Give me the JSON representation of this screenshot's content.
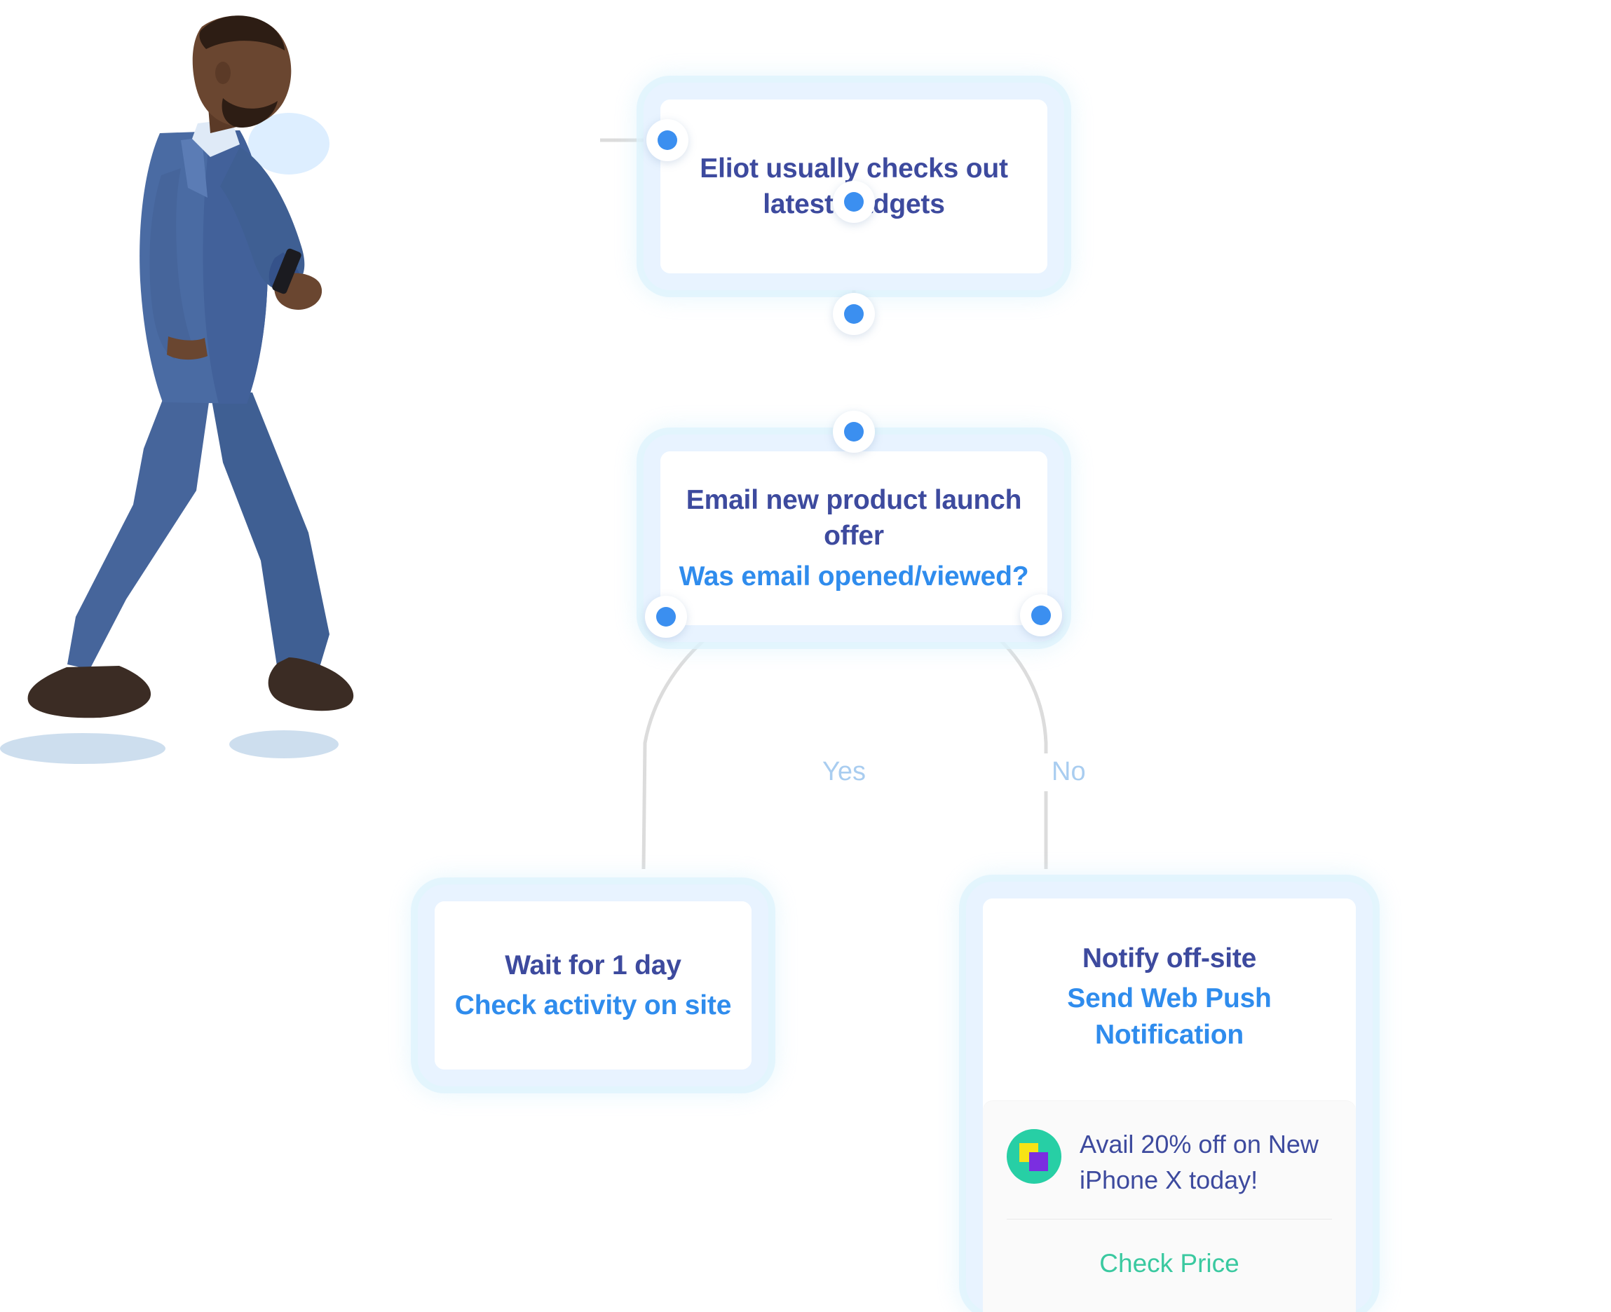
{
  "flow": {
    "nodes": [
      {
        "id": "node-1",
        "title": "Eliot usually checks out latest gadgets",
        "subtitle": ""
      },
      {
        "id": "node-2",
        "title": "Email new product launch offer",
        "subtitle": "Was email opened/viewed?"
      },
      {
        "id": "node-3",
        "title": "Wait for 1 day",
        "subtitle": "Check activity on site"
      },
      {
        "id": "node-4",
        "title": "Notify off-site",
        "subtitle": "Send Web Push Notification"
      }
    ],
    "branch_labels": {
      "yes": "Yes",
      "no": "No"
    }
  },
  "push_notification": {
    "icon_name": "app-squares-icon",
    "message_line_1": "Avail 20% off on New",
    "message_line_2": "iPhone X today!",
    "action_label": "Check Price"
  },
  "illustration": {
    "alt_name": "walking-businessman-with-phone"
  },
  "colors": {
    "title_navy": "#3d4a9e",
    "subtitle_blue": "#2f8ced",
    "dot_blue": "#3b8ff0",
    "node_frame": "#e8f3ff",
    "branch_label": "#a9cdf0",
    "action_green": "#3ac9a0",
    "icon_circle_teal": "#27cfa5",
    "icon_square_yellow": "#f7e316",
    "icon_square_purple": "#7b2ee0"
  }
}
